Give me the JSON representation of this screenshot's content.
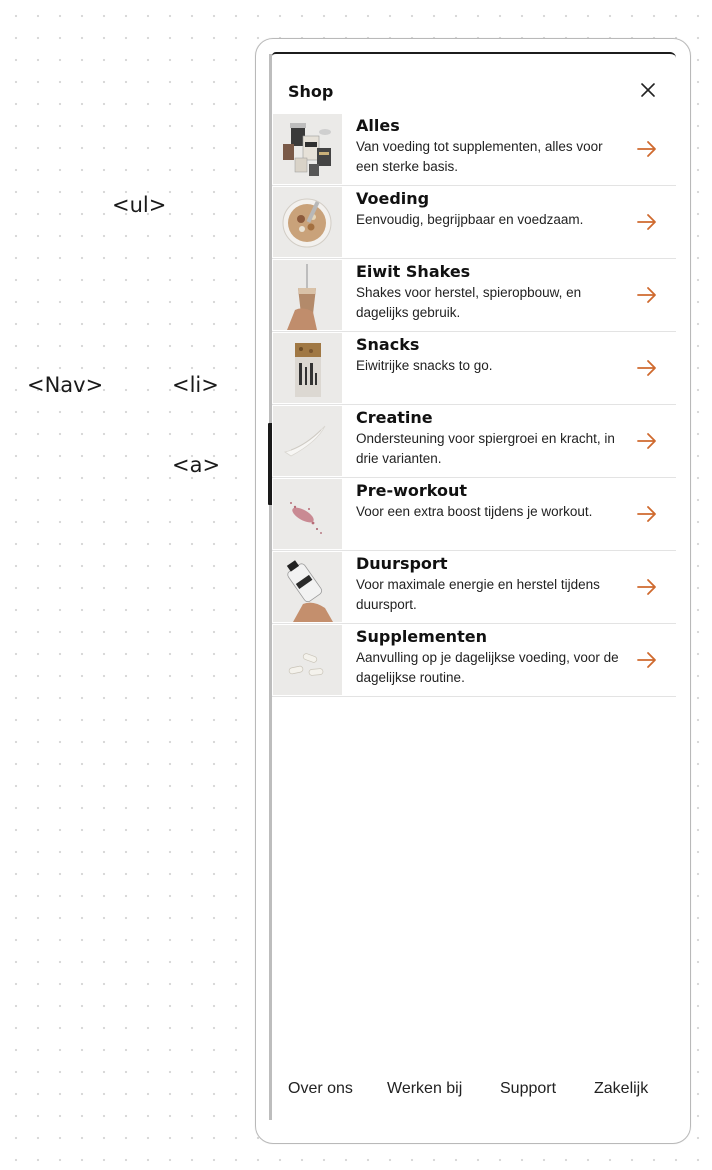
{
  "annotations": {
    "ul": "<ul>",
    "nav": "<Nav>",
    "li": "<li>",
    "a": "<a>"
  },
  "panel": {
    "title": "Shop",
    "close_icon": "close-icon"
  },
  "items": [
    {
      "title": "Alles",
      "description": "Van voeding tot supplementen, alles voor een sterke basis.",
      "icon": "arrow-right-icon",
      "thumb": "alles-image"
    },
    {
      "title": "Voeding",
      "description": "Eenvoudig, begrijpbaar en voedzaam.",
      "icon": "arrow-right-icon",
      "thumb": "voeding-image"
    },
    {
      "title": "Eiwit Shakes",
      "description": "Shakes voor herstel, spieropbouw, en dagelijks gebruik.",
      "icon": "arrow-right-icon",
      "thumb": "eiwit-shakes-image"
    },
    {
      "title": "Snacks",
      "description": "Eiwitrijke snacks to go.",
      "icon": "arrow-right-icon",
      "thumb": "snacks-image"
    },
    {
      "title": "Creatine",
      "description": "Ondersteuning voor spiergroei en kracht, in drie varianten.",
      "icon": "arrow-right-icon",
      "thumb": "creatine-image"
    },
    {
      "title": "Pre-workout",
      "description": "Voor een extra boost tijdens je workout.",
      "icon": "arrow-right-icon",
      "thumb": "pre-workout-image"
    },
    {
      "title": "Duursport",
      "description": "Voor maximale energie en herstel tijdens duursport.",
      "icon": "arrow-right-icon",
      "thumb": "duursport-image"
    },
    {
      "title": "Supplementen",
      "description": "Aanvulling op je dagelijkse voeding, voor de dagelijkse routine.",
      "icon": "arrow-right-icon",
      "thumb": "supplementen-image"
    }
  ],
  "footer": {
    "links": [
      "Over ons",
      "Werken bij",
      "Support",
      "Zakelijk"
    ]
  },
  "colors": {
    "accent": "#cf6a2e",
    "text": "#111111",
    "divider": "#e3e3e3",
    "thumb_bg": "#ebeae8"
  }
}
